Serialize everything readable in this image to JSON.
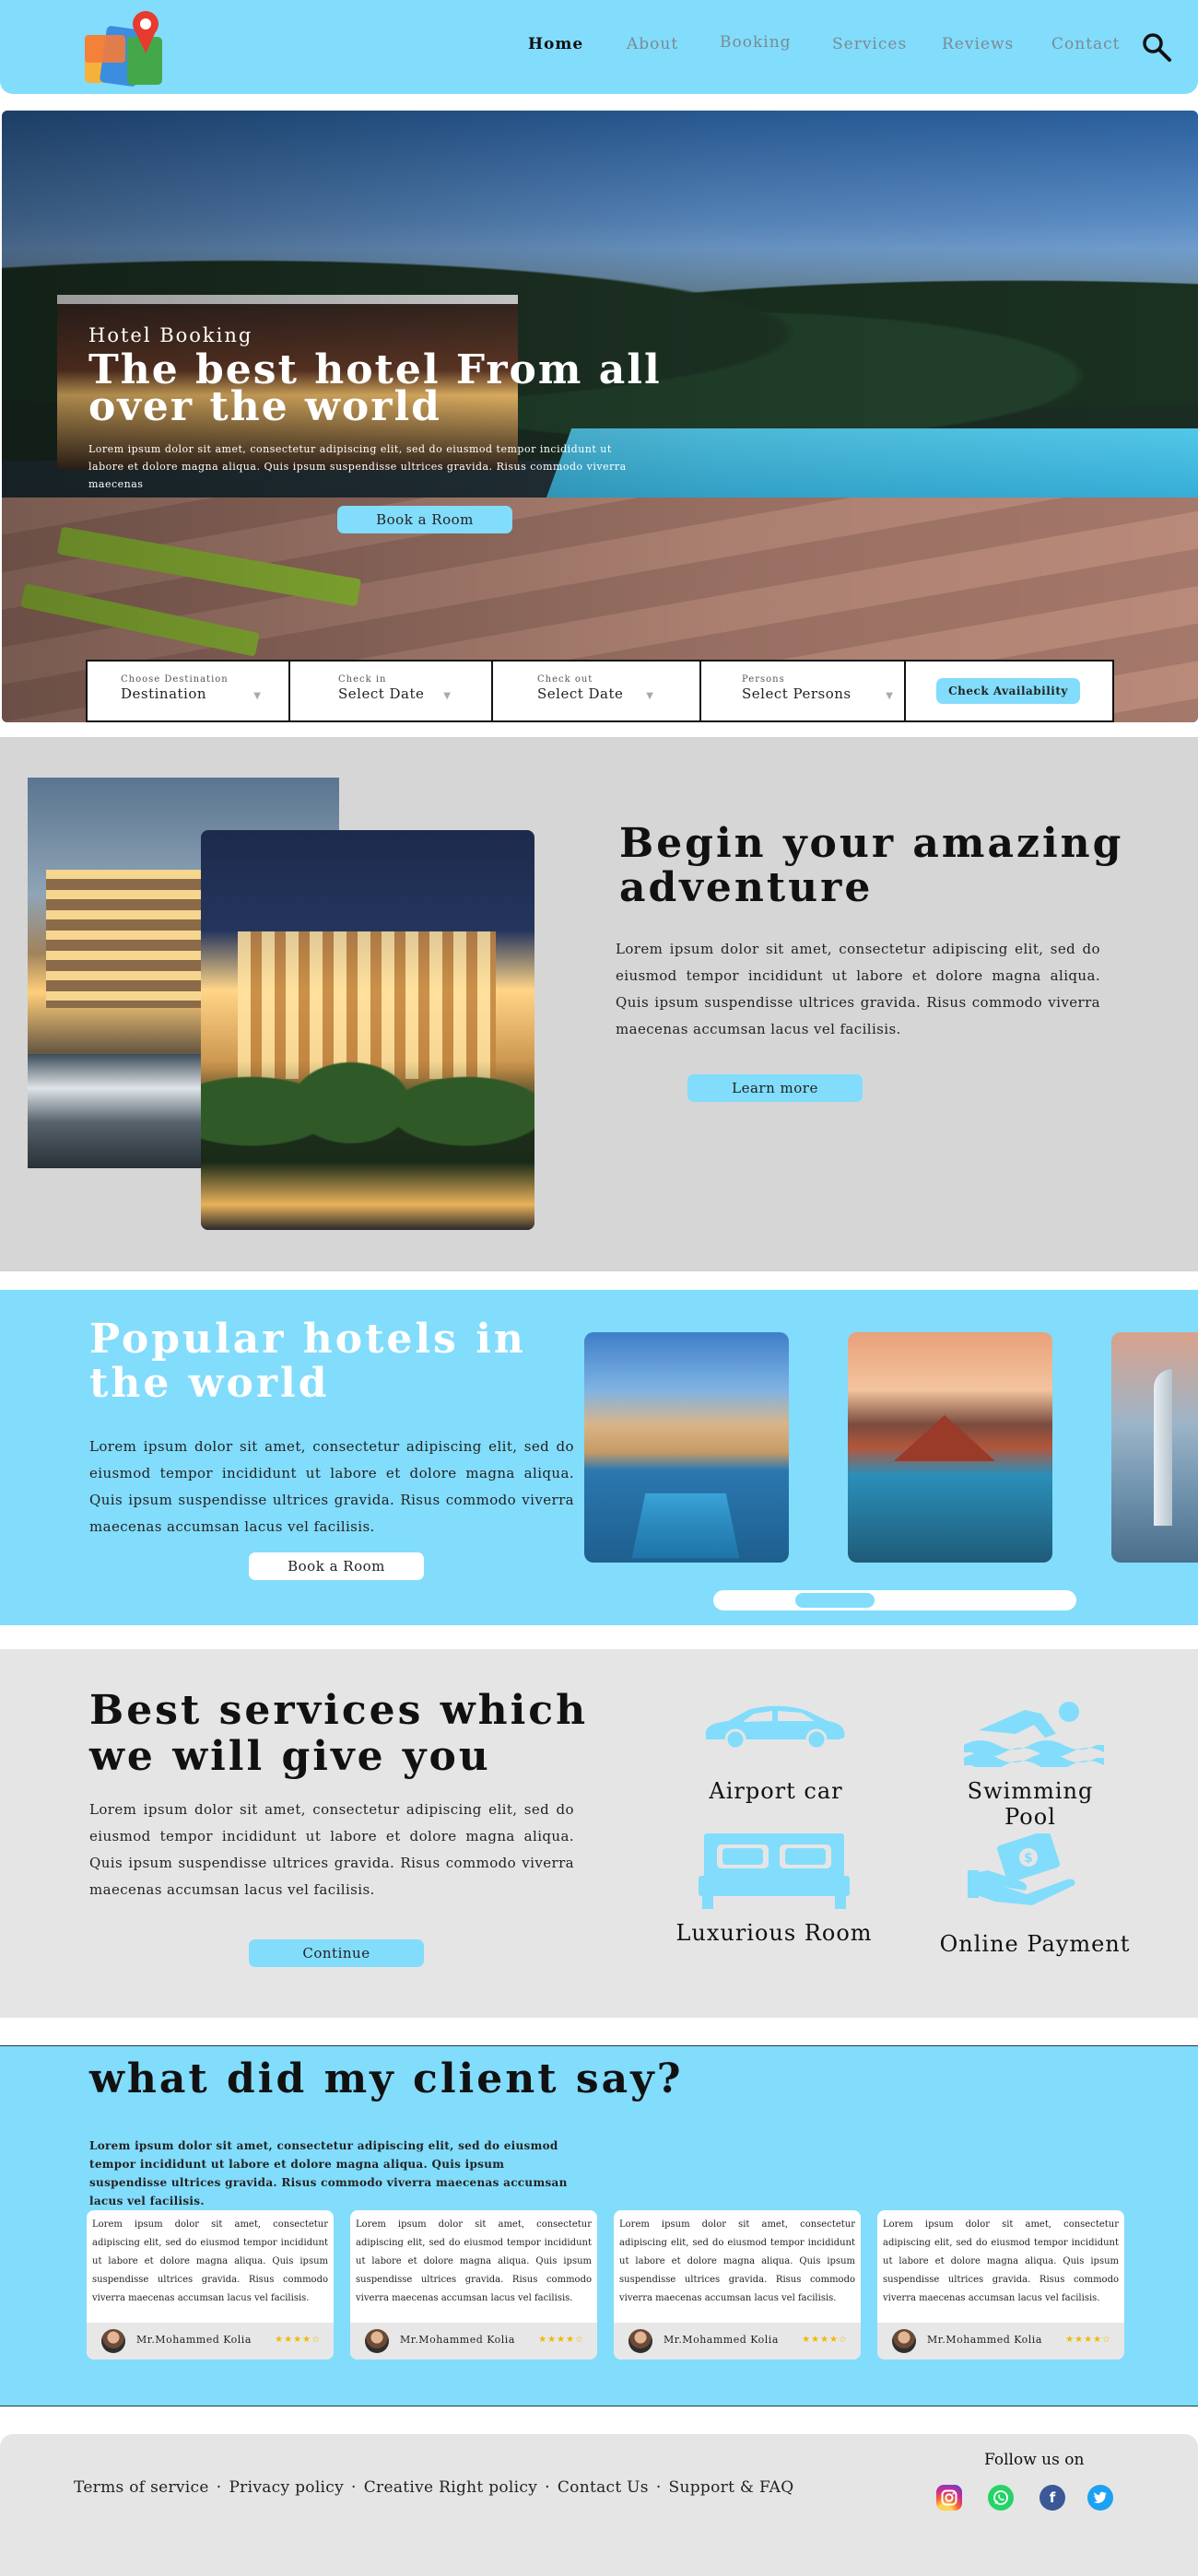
{
  "header": {
    "nav": [
      "Home",
      "About",
      "Booking",
      "Services",
      "Reviews",
      "Contact"
    ],
    "active": "Home"
  },
  "hero": {
    "kicker": "Hotel Booking",
    "title": "The best hotel From all over the world",
    "text": "Lorem ipsum dolor sit amet, consectetur adipiscing elit, sed do eiusmod tempor incididunt ut labore et dolore magna aliqua. Quis ipsum suspendisse ultrices gravida. Risus commodo viverra maecenas",
    "button": "Book a Room"
  },
  "booking": {
    "destination_label": "Choose Destination",
    "destination_value": "Destination",
    "checkin_label": "Check in",
    "checkin_value": "Select Date",
    "checkout_label": "Check out",
    "checkout_value": "Select Date",
    "persons_label": "Persons",
    "persons_value": "Select Persons",
    "button": "Check Availability"
  },
  "adventure": {
    "title": "Begin your amazing adventure",
    "text": "Lorem ipsum dolor sit amet, consectetur adipiscing elit, sed do eiusmod tempor incididunt ut labore et dolore magna aliqua. Quis ipsum suspendisse ultrices gravida. Risus commodo viverra maecenas accumsan lacus vel facilisis.",
    "button": "Learn more"
  },
  "popular": {
    "title": "Popular hotels in the world",
    "text": "Lorem ipsum dolor sit amet, consectetur adipiscing elit, sed do eiusmod tempor incididunt ut labore et dolore magna aliqua. Quis ipsum suspendisse ultrices gravida. Risus commodo viverra maecenas accumsan lacus vel facilisis.",
    "button": "Book a Room"
  },
  "services": {
    "title": "Best services which we will give you",
    "text": "Lorem ipsum dolor sit amet, consectetur adipiscing elit, sed do eiusmod tempor incididunt ut labore et dolore magna aliqua. Quis ipsum suspendisse ultrices gravida. Risus commodo viverra maecenas accumsan lacus vel facilisis.",
    "button": "Continue",
    "items": [
      {
        "label": "Airport car",
        "icon": "car-icon"
      },
      {
        "label": "Swimming Pool",
        "icon": "swimmer-icon"
      },
      {
        "label": "Luxurious Room",
        "icon": "bed-icon"
      },
      {
        "label": "Online Payment",
        "icon": "payment-hand-icon"
      }
    ]
  },
  "testimonials": {
    "title": "what did my client say?",
    "intro": "Lorem ipsum dolor sit amet, consectetur adipiscing elit, sed do eiusmod tempor incididunt ut labore et dolore magna aliqua. Quis ipsum suspendisse ultrices gravida. Risus commodo viverra maecenas accumsan lacus vel facilisis.",
    "cards": [
      {
        "text": "Lorem ipsum dolor sit amet, consectetur adipiscing elit, sed do eiusmod tempor incididunt ut labore et dolore magna aliqua. Quis ipsum suspendisse ultrices gravida. Risus commodo viverra maecenas accumsan lacus vel facilisis.",
        "name": "Mr.Mohammed Kolia",
        "stars": 4
      },
      {
        "text": "Lorem ipsum dolor sit amet, consectetur adipiscing elit, sed do eiusmod tempor incididunt ut labore et dolore magna aliqua. Quis ipsum suspendisse ultrices gravida. Risus commodo viverra maecenas accumsan lacus vel facilisis.",
        "name": "Mr.Mohammed Kolia",
        "stars": 4
      },
      {
        "text": "Lorem ipsum dolor sit amet, consectetur adipiscing elit, sed do eiusmod tempor incididunt ut labore et dolore magna aliqua. Quis ipsum suspendisse ultrices gravida. Risus commodo viverra maecenas accumsan lacus vel facilisis.",
        "name": "Mr.Mohammed Kolia",
        "stars": 4
      },
      {
        "text": "Lorem ipsum dolor sit amet, consectetur adipiscing elit, sed do eiusmod tempor incididunt ut labore et dolore magna aliqua. Quis ipsum suspendisse ultrices gravida. Risus commodo viverra maecenas accumsan lacus vel facilisis.",
        "name": "Mr.Mohammed Kolia",
        "stars": 4
      }
    ]
  },
  "footer": {
    "links": [
      "Terms of service",
      "Privacy policy",
      "Creative Right policy",
      "Contact Us",
      "Support & FAQ"
    ],
    "separator": "·",
    "follow": "Follow us on",
    "social": [
      "instagram-icon",
      "whatsapp-icon",
      "facebook-icon",
      "twitter-icon"
    ]
  },
  "colors": {
    "accent": "#82dcfc",
    "section_gray": "#d6d6d6",
    "section_light": "#e5e5e5",
    "star": "#f2b705"
  }
}
